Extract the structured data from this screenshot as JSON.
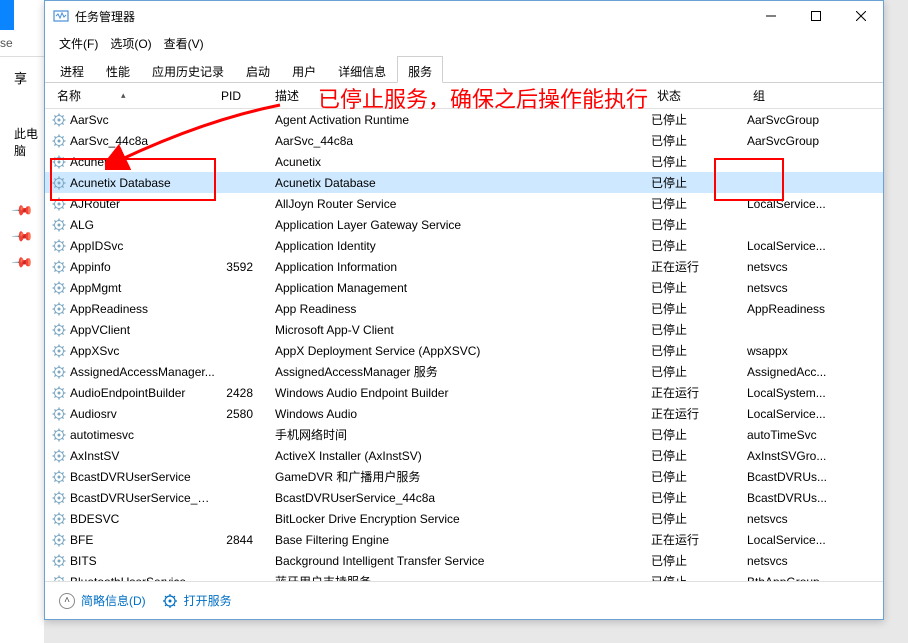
{
  "titlebar": {
    "title": "任务管理器"
  },
  "menubar": {
    "file": "文件(F)",
    "options": "选项(O)",
    "view": "查看(V)"
  },
  "tabs": [
    {
      "label": "进程",
      "active": false
    },
    {
      "label": "性能",
      "active": false
    },
    {
      "label": "应用历史记录",
      "active": false
    },
    {
      "label": "启动",
      "active": false
    },
    {
      "label": "用户",
      "active": false
    },
    {
      "label": "详细信息",
      "active": false
    },
    {
      "label": "服务",
      "active": true
    }
  ],
  "columns": {
    "name": "名称",
    "pid": "PID",
    "desc": "描述",
    "status": "状态",
    "group": "组"
  },
  "services": [
    {
      "name": "AarSvc",
      "pid": "",
      "desc": "Agent Activation Runtime",
      "status": "已停止",
      "group": "AarSvcGroup"
    },
    {
      "name": "AarSvc_44c8a",
      "pid": "",
      "desc": "AarSvc_44c8a",
      "status": "已停止",
      "group": "AarSvcGroup"
    },
    {
      "name": "Acunetix",
      "pid": "",
      "desc": "Acunetix",
      "status": "已停止",
      "group": ""
    },
    {
      "name": "Acunetix Database",
      "pid": "",
      "desc": "Acunetix Database",
      "status": "已停止",
      "group": "",
      "selected": true
    },
    {
      "name": "AJRouter",
      "pid": "",
      "desc": "AllJoyn Router Service",
      "status": "已停止",
      "group": "LocalService..."
    },
    {
      "name": "ALG",
      "pid": "",
      "desc": "Application Layer Gateway Service",
      "status": "已停止",
      "group": ""
    },
    {
      "name": "AppIDSvc",
      "pid": "",
      "desc": "Application Identity",
      "status": "已停止",
      "group": "LocalService..."
    },
    {
      "name": "Appinfo",
      "pid": "3592",
      "desc": "Application Information",
      "status": "正在运行",
      "group": "netsvcs"
    },
    {
      "name": "AppMgmt",
      "pid": "",
      "desc": "Application Management",
      "status": "已停止",
      "group": "netsvcs"
    },
    {
      "name": "AppReadiness",
      "pid": "",
      "desc": "App Readiness",
      "status": "已停止",
      "group": "AppReadiness"
    },
    {
      "name": "AppVClient",
      "pid": "",
      "desc": "Microsoft App-V Client",
      "status": "已停止",
      "group": ""
    },
    {
      "name": "AppXSvc",
      "pid": "",
      "desc": "AppX Deployment Service (AppXSVC)",
      "status": "已停止",
      "group": "wsappx"
    },
    {
      "name": "AssignedAccessManager...",
      "pid": "",
      "desc": "AssignedAccessManager 服务",
      "status": "已停止",
      "group": "AssignedAcc..."
    },
    {
      "name": "AudioEndpointBuilder",
      "pid": "2428",
      "desc": "Windows Audio Endpoint Builder",
      "status": "正在运行",
      "group": "LocalSystem..."
    },
    {
      "name": "Audiosrv",
      "pid": "2580",
      "desc": "Windows Audio",
      "status": "正在运行",
      "group": "LocalService..."
    },
    {
      "name": "autotimesvc",
      "pid": "",
      "desc": "手机网络时间",
      "status": "已停止",
      "group": "autoTimeSvc"
    },
    {
      "name": "AxInstSV",
      "pid": "",
      "desc": "ActiveX Installer (AxInstSV)",
      "status": "已停止",
      "group": "AxInstSVGro..."
    },
    {
      "name": "BcastDVRUserService",
      "pid": "",
      "desc": "GameDVR 和广播用户服务",
      "status": "已停止",
      "group": "BcastDVRUs..."
    },
    {
      "name": "BcastDVRUserService_44...",
      "pid": "",
      "desc": "BcastDVRUserService_44c8a",
      "status": "已停止",
      "group": "BcastDVRUs..."
    },
    {
      "name": "BDESVC",
      "pid": "",
      "desc": "BitLocker Drive Encryption Service",
      "status": "已停止",
      "group": "netsvcs"
    },
    {
      "name": "BFE",
      "pid": "2844",
      "desc": "Base Filtering Engine",
      "status": "正在运行",
      "group": "LocalService..."
    },
    {
      "name": "BITS",
      "pid": "",
      "desc": "Background Intelligent Transfer Service",
      "status": "已停止",
      "group": "netsvcs"
    },
    {
      "name": "BluetoothUserService",
      "pid": "",
      "desc": "蓝牙用户支持服务",
      "status": "已停止",
      "group": "BthAppGroup"
    }
  ],
  "footer": {
    "brief": "简略信息(D)",
    "open_services": "打开服务"
  },
  "left": {
    "se": "se",
    "share": "享",
    "pc": "此电脑"
  },
  "annotation": "已停止服务，确保之后操作能执行"
}
